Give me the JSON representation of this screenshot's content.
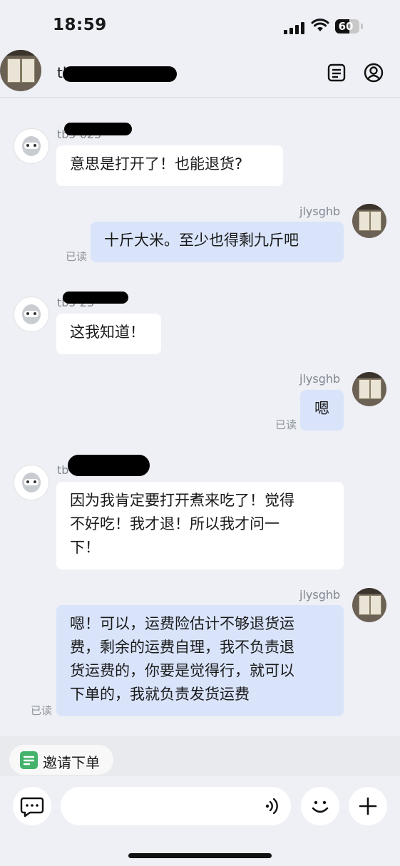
{
  "status_bar": {
    "time": "18:59",
    "battery": "60",
    "battery_level": 0.6
  },
  "header": {
    "title": "tb",
    "icons": [
      "notes-icon",
      "profile-icon"
    ]
  },
  "messages": [
    {
      "side": "left",
      "name": "tb5 023",
      "text": "意思是打开了！也能退货?"
    },
    {
      "side": "right",
      "name": "jlysghb",
      "text": "十斤大米。至少也得剩九斤吧",
      "read": "已读"
    },
    {
      "side": "left",
      "name": "tb5 23",
      "text": "这我知道！"
    },
    {
      "side": "right",
      "name": "jlysghb",
      "text": "嗯",
      "read": "已读"
    },
    {
      "side": "left",
      "name": "tb",
      "lines": [
        "因为我肯定要打开煮来吃了！觉得",
        "不好吃！我才退！所以我才问一",
        "下！"
      ]
    },
    {
      "side": "right",
      "name": "jlysghb",
      "lines": [
        "嗯！可以，运费险估计不够退货运",
        "费，剩余的运费自理，我不负责退",
        "货运费的，你要是觉得行，就可以",
        "下单的，我就负责发货运费"
      ],
      "read": "已读"
    }
  ],
  "invite": {
    "label": "邀请下单"
  },
  "input": {
    "placeholder": ""
  }
}
